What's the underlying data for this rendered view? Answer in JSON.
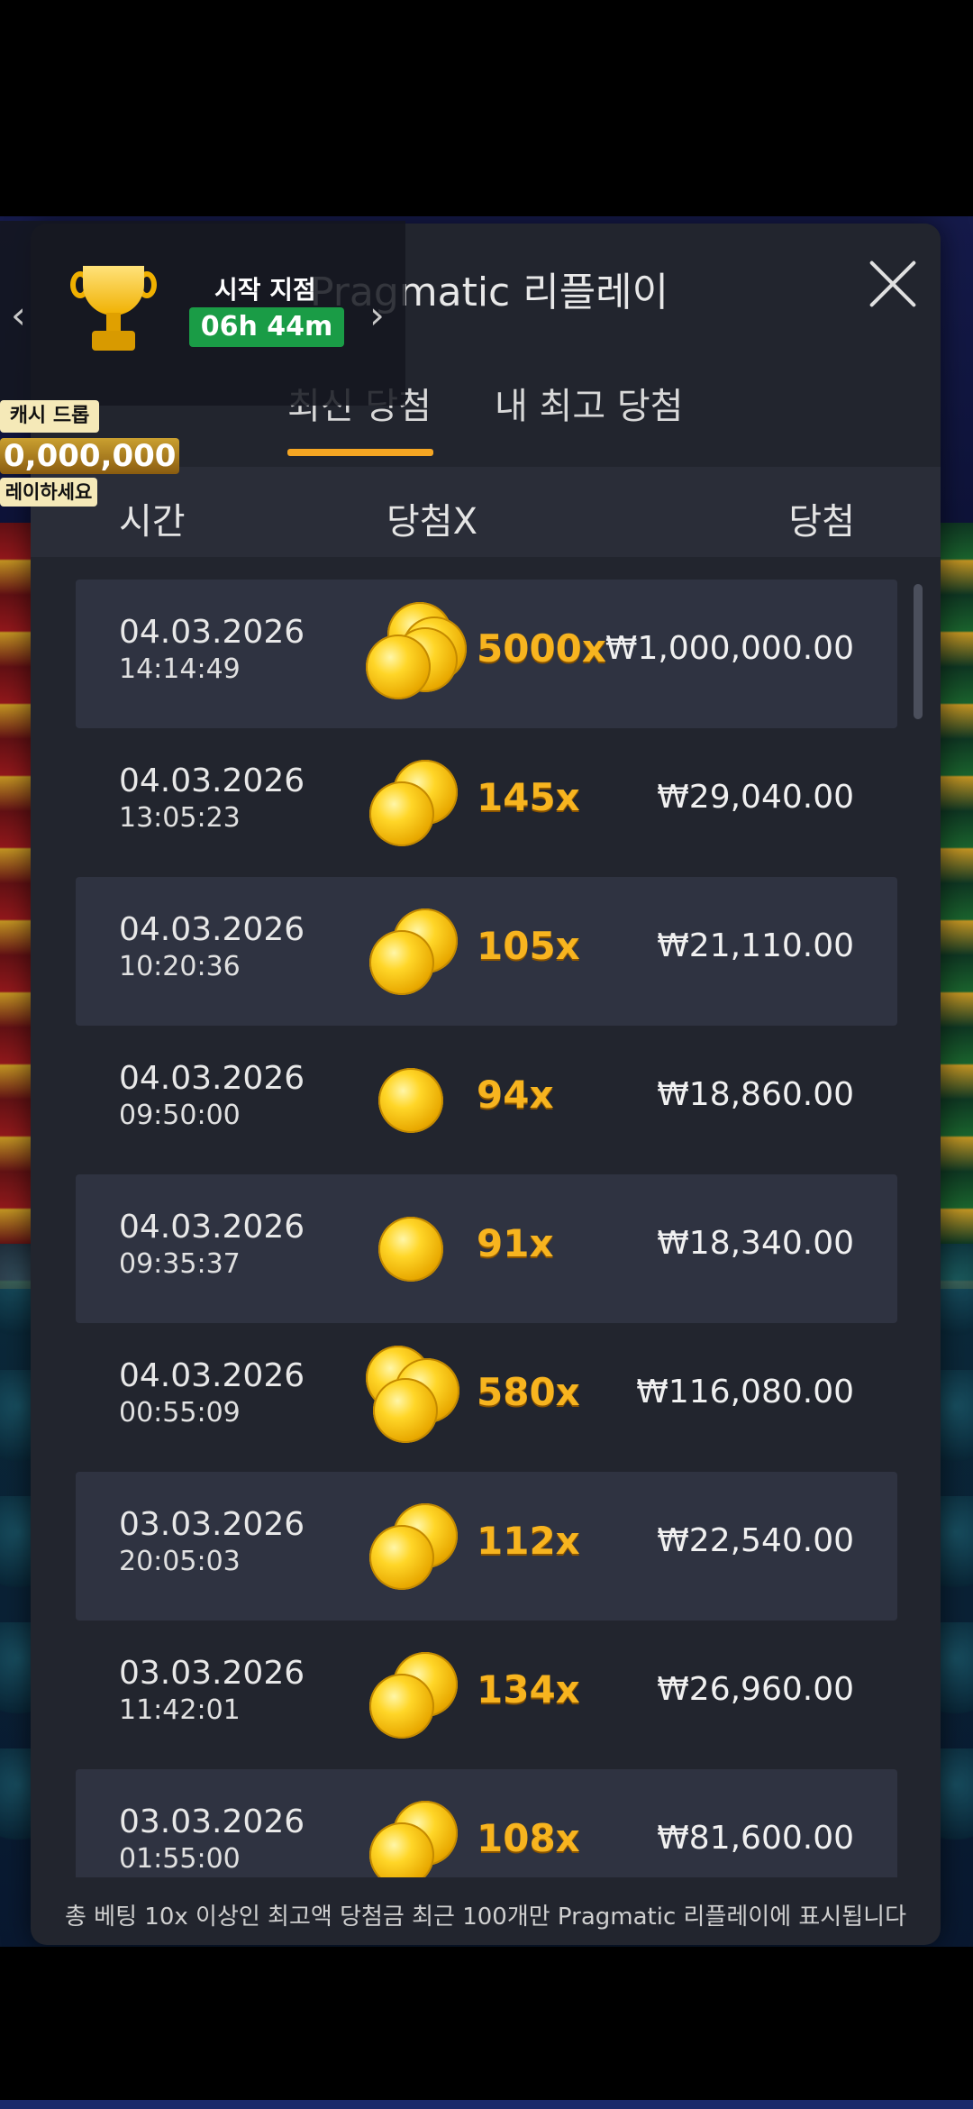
{
  "modal": {
    "title": "Pragmatic 리플레이",
    "tabs": {
      "latest": "최신 당첨",
      "best": "내 최고 당첨"
    },
    "columns": {
      "time": "시간",
      "multiplier": "당첨X",
      "win": "당첨"
    },
    "rows": [
      {
        "date": "04.03.2026",
        "time": "14:14:49",
        "multiplier": "5000x",
        "amount": "₩1,000,000.00",
        "coins": 4
      },
      {
        "date": "04.03.2026",
        "time": "13:05:23",
        "multiplier": "145x",
        "amount": "₩29,040.00",
        "coins": 2
      },
      {
        "date": "04.03.2026",
        "time": "10:20:36",
        "multiplier": "105x",
        "amount": "₩21,110.00",
        "coins": 2
      },
      {
        "date": "04.03.2026",
        "time": "09:50:00",
        "multiplier": "94x",
        "amount": "₩18,860.00",
        "coins": 1
      },
      {
        "date": "04.03.2026",
        "time": "09:35:37",
        "multiplier": "91x",
        "amount": "₩18,340.00",
        "coins": 1
      },
      {
        "date": "04.03.2026",
        "time": "00:55:09",
        "multiplier": "580x",
        "amount": "₩116,080.00",
        "coins": 3
      },
      {
        "date": "03.03.2026",
        "time": "20:05:03",
        "multiplier": "112x",
        "amount": "₩22,540.00",
        "coins": 2
      },
      {
        "date": "03.03.2026",
        "time": "11:42:01",
        "multiplier": "134x",
        "amount": "₩26,960.00",
        "coins": 2
      },
      {
        "date": "03.03.2026",
        "time": "01:55:00",
        "multiplier": "108x",
        "amount": "₩81,600.00",
        "coins": 2
      }
    ],
    "footer": "총 베팅 10x 이상인 최고액 당첨금 최근 100개만 Pragmatic 리플레이에 표시됩니다"
  },
  "promo": {
    "start_label": "시작 지점",
    "timer": "06h 44m",
    "left_arrow": "‹",
    "right_arrow": "›",
    "trophy_icon": "trophy-icon"
  },
  "cashdrop": {
    "title": "캐시 드롭",
    "amount": "0,000,000",
    "play": "레이하세요"
  },
  "colors": {
    "accent": "#f5a623",
    "multiplier": "#f7b41f",
    "timer_bg": "#1a9c46",
    "modal_bg": "#22252e",
    "row_shade": "#2f3341"
  }
}
